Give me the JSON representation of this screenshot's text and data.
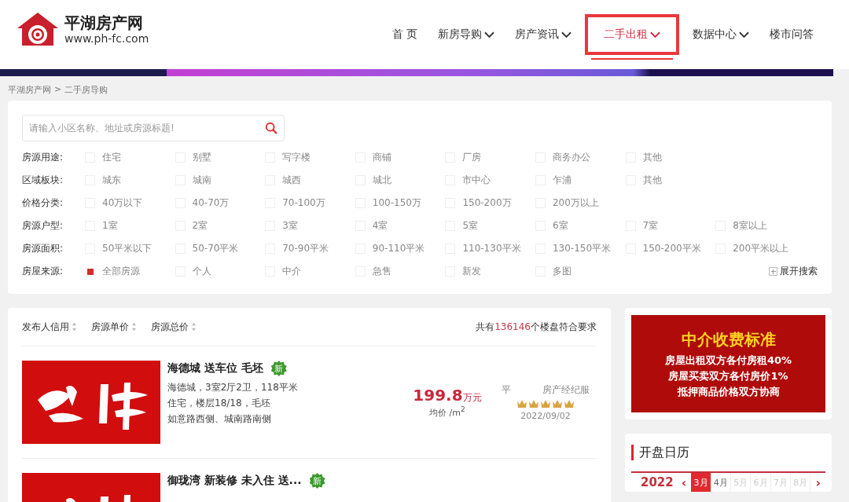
{
  "logo": {
    "name": "平湖房产网",
    "url": "www.ph-fc.com"
  },
  "nav": [
    {
      "label": "首 页",
      "dropdown": false,
      "selected": false
    },
    {
      "label": "新房导购",
      "dropdown": true,
      "selected": false
    },
    {
      "label": "房产资讯",
      "dropdown": true,
      "selected": false
    },
    {
      "label": "二手出租",
      "dropdown": true,
      "selected": true
    },
    {
      "label": "数据中心",
      "dropdown": true,
      "selected": false
    },
    {
      "label": "楼市问答",
      "dropdown": false,
      "selected": false
    }
  ],
  "breadcrumb": [
    "平湖房产网",
    ">",
    "二手房导购"
  ],
  "search": {
    "placeholder": "请输入小区名称、地址或房源标题!"
  },
  "filters": [
    {
      "label": "房源用途:",
      "options": [
        {
          "label": "住宅",
          "checked": false
        },
        {
          "label": "别墅",
          "checked": false
        },
        {
          "label": "写字楼",
          "checked": false
        },
        {
          "label": "商铺",
          "checked": false
        },
        {
          "label": "厂房",
          "checked": false
        },
        {
          "label": "商务办公",
          "checked": false
        },
        {
          "label": "其他",
          "checked": false
        }
      ]
    },
    {
      "label": "区域板块:",
      "options": [
        {
          "label": "城东",
          "checked": false
        },
        {
          "label": "城南",
          "checked": false
        },
        {
          "label": "城西",
          "checked": false
        },
        {
          "label": "城北",
          "checked": false
        },
        {
          "label": "市中心",
          "checked": false
        },
        {
          "label": "乍浦",
          "checked": false
        },
        {
          "label": "其他",
          "checked": false
        }
      ]
    },
    {
      "label": "价格分类:",
      "options": [
        {
          "label": "40万以下",
          "checked": false
        },
        {
          "label": "40-70万",
          "checked": false
        },
        {
          "label": "70-100万",
          "checked": false
        },
        {
          "label": "100-150万",
          "checked": false
        },
        {
          "label": "150-200万",
          "checked": false
        },
        {
          "label": "200万以上",
          "checked": false
        }
      ]
    },
    {
      "label": "房源户型:",
      "options": [
        {
          "label": "1室",
          "checked": false
        },
        {
          "label": "2室",
          "checked": false
        },
        {
          "label": "3室",
          "checked": false
        },
        {
          "label": "4室",
          "checked": false
        },
        {
          "label": "5室",
          "checked": false
        },
        {
          "label": "6室",
          "checked": false
        },
        {
          "label": "7室",
          "checked": false
        },
        {
          "label": "8室以上",
          "checked": false
        }
      ]
    },
    {
      "label": "房源面积:",
      "options": [
        {
          "label": "50平米以下",
          "checked": false
        },
        {
          "label": "50-70平米",
          "checked": false
        },
        {
          "label": "70-90平米",
          "checked": false
        },
        {
          "label": "90-110平米",
          "checked": false
        },
        {
          "label": "110-130平米",
          "checked": false
        },
        {
          "label": "130-150平米",
          "checked": false
        },
        {
          "label": "150-200平米",
          "checked": false
        },
        {
          "label": "200平米以上",
          "checked": false
        }
      ]
    },
    {
      "label": "房屋来源:",
      "options": [
        {
          "label": "全部房源",
          "checked": true
        },
        {
          "label": "个人",
          "checked": false
        },
        {
          "label": "中介",
          "checked": false
        },
        {
          "label": "急售",
          "checked": false
        },
        {
          "label": "新发",
          "checked": false
        },
        {
          "label": "多图",
          "checked": false
        }
      ]
    }
  ],
  "expand_search": "展开搜索",
  "sort": [
    "发布人信用",
    "房源单价",
    "房源总价"
  ],
  "result_count": {
    "prefix": "共有",
    "count": "136146",
    "suffix": "个楼盘符合要求"
  },
  "listings": [
    {
      "title": "海德城 送车位 毛坯",
      "badge": "新",
      "lines": [
        "海德城，3室2厅2卫，118平米",
        "住宅，楼层18/18，毛坯",
        "如意路西侧、城南路南侧"
      ],
      "price": "199.8",
      "price_unit": "万元",
      "unit_price": "均价 /m$^{2}$",
      "agent_prefix": "平",
      "agent": "房产经纪服",
      "stars": 5,
      "date": "2022/09/02"
    },
    {
      "title": "御珑湾 新装修 未入住 送...",
      "badge": "新"
    }
  ],
  "ad": {
    "title": "中介收费标准",
    "lines": [
      "房屋出租双方各付房租**40%**",
      "房屋买卖双方各付房价**1%**",
      "抵押商品价格**双方协商**"
    ]
  },
  "calendar": {
    "title": "开盘日历",
    "year": "2022",
    "prev": "‹",
    "next": "›",
    "months": [
      {
        "label": "3月",
        "selected": true,
        "disabled": false
      },
      {
        "label": "4月",
        "selected": false,
        "disabled": false
      },
      {
        "label": "5月",
        "selected": false,
        "disabled": true
      },
      {
        "label": "6月",
        "selected": false,
        "disabled": true
      },
      {
        "label": "7月",
        "selected": false,
        "disabled": true
      },
      {
        "label": "8月",
        "selected": false,
        "disabled": true
      }
    ]
  }
}
